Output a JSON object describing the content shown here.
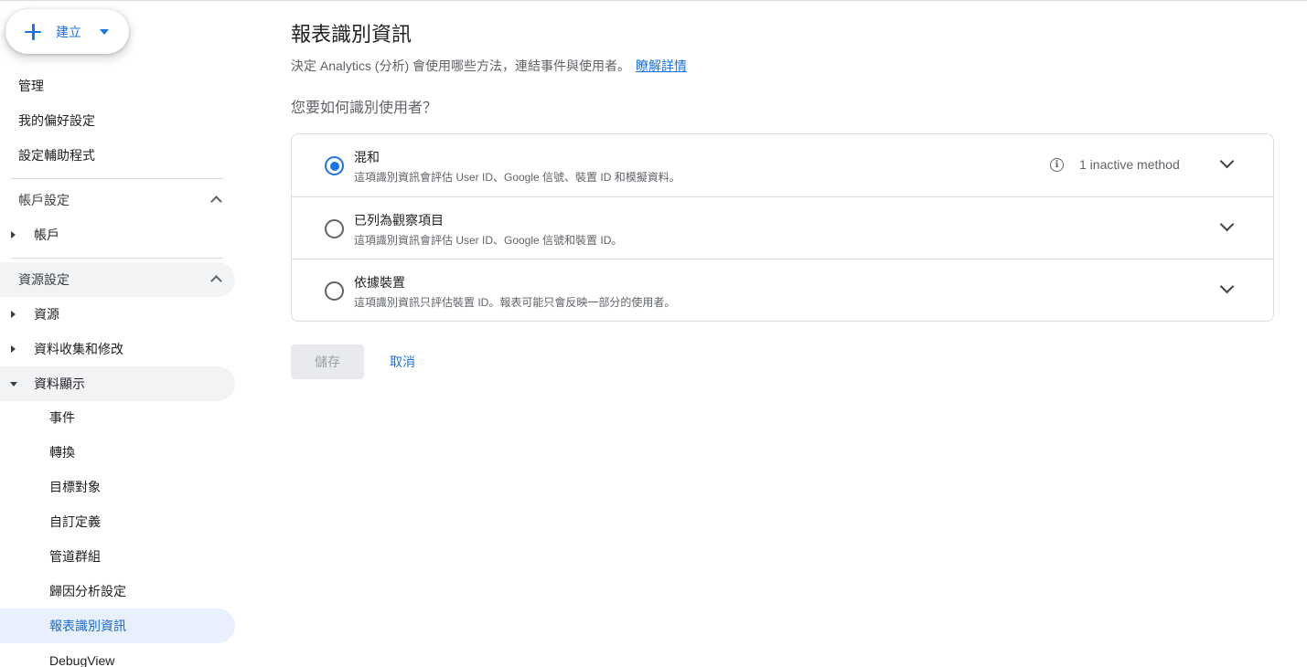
{
  "sidebar": {
    "create_label": "建立",
    "top_items": [
      "管理",
      "我的偏好設定",
      "設定輔助程式"
    ],
    "account_section": "帳戶設定",
    "account_item": "帳戶",
    "property_section": "資源設定",
    "property_items": [
      "資源",
      "資料收集和修改",
      "資料顯示"
    ],
    "display_items": [
      "事件",
      "轉換",
      "目標對象",
      "自訂定義",
      "管道群組",
      "歸因分析設定",
      "報表識別資訊",
      "DebugView"
    ]
  },
  "main": {
    "title": "報表識別資訊",
    "subtitle": "決定 Analytics (分析) 會使用哪些方法，連結事件與使用者。",
    "learn_more": "瞭解詳情",
    "question": "您要如何識別使用者？",
    "options": [
      {
        "title": "混和",
        "description": "這項識別資訊會評估 User ID、Google 信號、裝置 ID 和模擬資料。",
        "selected": true,
        "note": "1 inactive method"
      },
      {
        "title": "已列為觀察項目",
        "description": "這項識別資訊會評估 User ID、Google 信號和裝置 ID。",
        "selected": false
      },
      {
        "title": "依據裝置",
        "description": "這項識別資訊只評估裝置 ID。報表可能只會反映一部分的使用者。",
        "selected": false
      }
    ],
    "save_label": "儲存",
    "cancel_label": "取消"
  },
  "icons": {
    "create": "plus-icon",
    "create_menu": "caret-down-icon",
    "collapse": "chevron-up-icon",
    "tree_collapsed": "triangle-right-icon",
    "tree_expanded": "triangle-down-icon",
    "info": "info-icon",
    "expand": "chevron-down-icon"
  },
  "colors": {
    "accent": "#1a73e8",
    "selected_bg": "#e8f0fe",
    "border": "#dadce0",
    "text_secondary": "#5f6368"
  }
}
